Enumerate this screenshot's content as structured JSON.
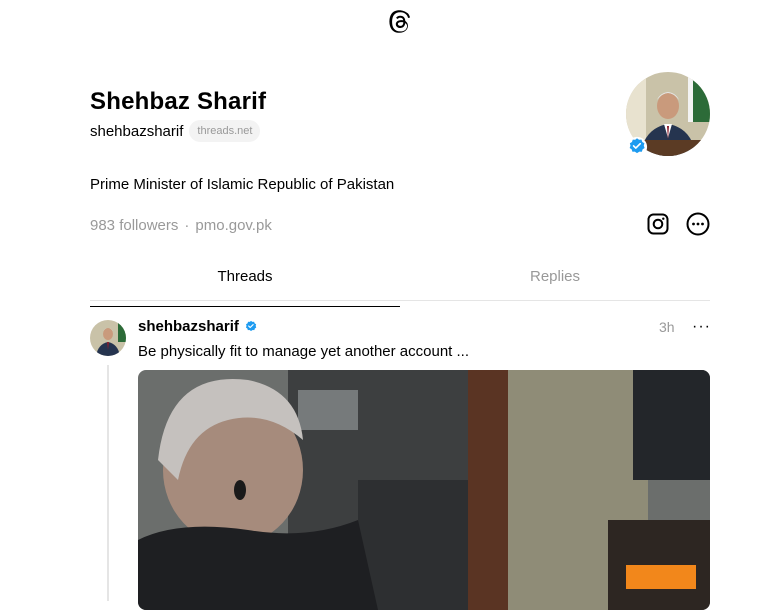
{
  "profile": {
    "name": "Shehbaz Sharif",
    "handle": "shehbazsharif",
    "domain_pill": "threads.net",
    "bio": "Prime Minister of Islamic Republic of Pakistan",
    "followers": "983 followers",
    "separator": "·",
    "link": "pmo.gov.pk"
  },
  "tabs": [
    {
      "label": "Threads",
      "active": true
    },
    {
      "label": "Replies",
      "active": false
    }
  ],
  "post": {
    "username": "shehbazsharif",
    "time": "3h",
    "more": "···",
    "text": "Be physically fit to manage yet another account ..."
  },
  "icons": {
    "logo": "threads-logo-icon",
    "verified": "verified-badge-icon",
    "instagram": "instagram-icon",
    "more": "more-options-icon"
  },
  "colors": {
    "verified_blue": "#1d9bf0",
    "muted": "#999999",
    "divider": "#e5e5e5"
  }
}
